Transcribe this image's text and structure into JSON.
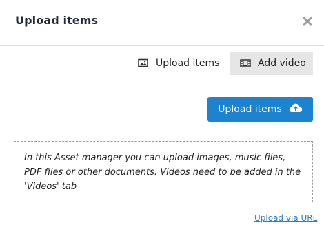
{
  "modal": {
    "title": "Upload items",
    "close_icon": "close-icon"
  },
  "tabs": [
    {
      "label": "Upload items",
      "icon": "image-icon",
      "active": false
    },
    {
      "label": "Add video",
      "icon": "film-icon",
      "active": true
    }
  ],
  "upload_button": {
    "label": "Upload items",
    "icon": "cloud-upload-icon",
    "color": "#1b83d0"
  },
  "info_text": "In this Asset manager you can upload images, music files, PDF files or other documents. Videos need to be added in the 'Videos' tab",
  "upload_via_url": "Upload via URL"
}
